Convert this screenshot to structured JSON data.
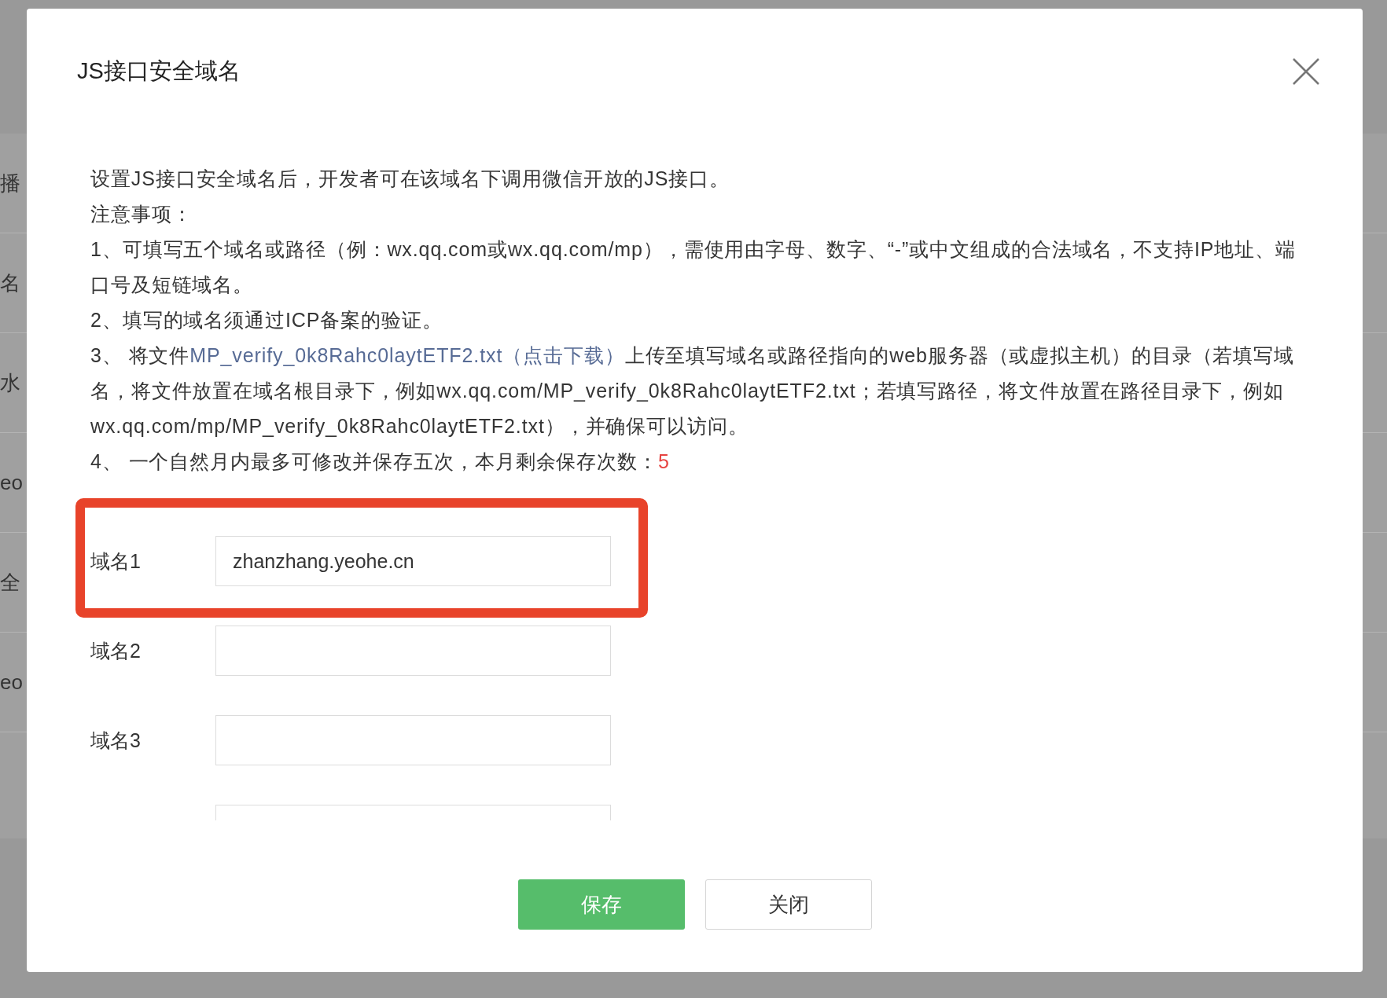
{
  "background_items": [
    "播",
    "名",
    "水",
    "eo",
    "全",
    "eo"
  ],
  "dialog": {
    "title": "JS接口安全域名",
    "intro": "设置JS接口安全域名后，开发者可在该域名下调用微信开放的JS接口。",
    "notes_heading": "注意事项：",
    "notes": [
      {
        "kind": "plain",
        "text": "1、可填写五个域名或路径（例：wx.qq.com或wx.qq.com/mp），需使用由字母、数字、“-”或中文组成的合法域名，不支持IP地址、端口号及短链域名。"
      },
      {
        "kind": "plain",
        "text": "2、填写的域名须通过ICP备案的验证。"
      },
      {
        "kind": "link",
        "prefix": "3、 将文件",
        "link": "MP_verify_0k8Rahc0laytETF2.txt（点击下载）",
        "suffix": "上传至填写域名或路径指向的web服务器（或虚拟主机）的目录（若填写域名，将文件放置在域名根目录下，例如wx.qq.com/MP_verify_0k8Rahc0laytETF2.txt；若填写路径，将文件放置在路径目录下，例如wx.qq.com/mp/MP_verify_0k8Rahc0laytETF2.txt），并确保可以访问。"
      },
      {
        "kind": "count",
        "text": "4、 一个自然月内最多可修改并保存五次，本月剩余保存次数：",
        "count": "5"
      }
    ],
    "fields": [
      {
        "label": "域名1",
        "value": "zhanzhang.yeohe.cn",
        "highlighted": true
      },
      {
        "label": "域名2",
        "highlighted": false
      },
      {
        "label": "域名3",
        "highlighted": false
      },
      {
        "highlighted": false
      }
    ],
    "buttons": [
      {
        "label": "保存",
        "kind": "primary"
      },
      {
        "label": "关闭",
        "kind": "secondary"
      }
    ]
  }
}
